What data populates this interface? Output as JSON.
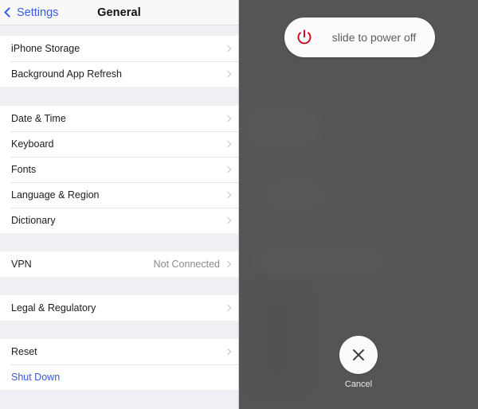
{
  "settings": {
    "nav": {
      "back_label": "Settings",
      "back_icon": "chevron-left-icon",
      "title": "General"
    },
    "groups": [
      {
        "rows": [
          {
            "label": "iPhone Storage",
            "value": "",
            "accessory": "chevron-right-icon",
            "style": "default"
          },
          {
            "label": "Background App Refresh",
            "value": "",
            "accessory": "chevron-right-icon",
            "style": "default"
          }
        ]
      },
      {
        "rows": [
          {
            "label": "Date & Time",
            "value": "",
            "accessory": "chevron-right-icon",
            "style": "default"
          },
          {
            "label": "Keyboard",
            "value": "",
            "accessory": "chevron-right-icon",
            "style": "default"
          },
          {
            "label": "Fonts",
            "value": "",
            "accessory": "chevron-right-icon",
            "style": "default"
          },
          {
            "label": "Language & Region",
            "value": "",
            "accessory": "chevron-right-icon",
            "style": "default"
          },
          {
            "label": "Dictionary",
            "value": "",
            "accessory": "chevron-right-icon",
            "style": "default"
          }
        ]
      },
      {
        "rows": [
          {
            "label": "VPN",
            "value": "Not Connected",
            "accessory": "chevron-right-icon",
            "style": "default"
          }
        ]
      },
      {
        "rows": [
          {
            "label": "Legal & Regulatory",
            "value": "",
            "accessory": "chevron-right-icon",
            "style": "default"
          }
        ]
      },
      {
        "rows": [
          {
            "label": "Reset",
            "value": "",
            "accessory": "chevron-right-icon",
            "style": "default"
          },
          {
            "label": "Shut Down",
            "value": "",
            "accessory": "",
            "style": "link"
          }
        ]
      }
    ]
  },
  "power_overlay": {
    "slider": {
      "text": "slide to power off",
      "knob_icon": "power-icon",
      "knob_icon_color": "#d0021b"
    },
    "cancel": {
      "label": "Cancel",
      "icon": "close-x-icon"
    },
    "background_color": "#555558"
  }
}
